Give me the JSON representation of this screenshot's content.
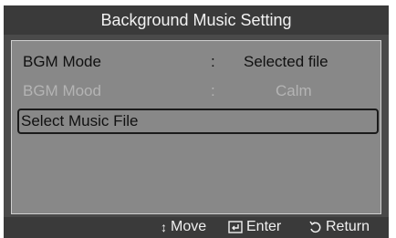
{
  "dialog": {
    "title": "Background Music Setting"
  },
  "menu": {
    "items": [
      {
        "label": "BGM Mode",
        "separator": ":",
        "value": "Selected file",
        "enabled": true
      },
      {
        "label": "BGM Mood",
        "separator": ":",
        "value": "Calm",
        "enabled": false
      },
      {
        "label": "Select Music File",
        "selected": true
      }
    ]
  },
  "footer": {
    "move_label": "Move",
    "enter_label": "Enter",
    "return_label": "Return",
    "move_icon": "up-down-arrows-icon",
    "enter_icon": "enter-icon",
    "return_icon": "return-icon"
  }
}
